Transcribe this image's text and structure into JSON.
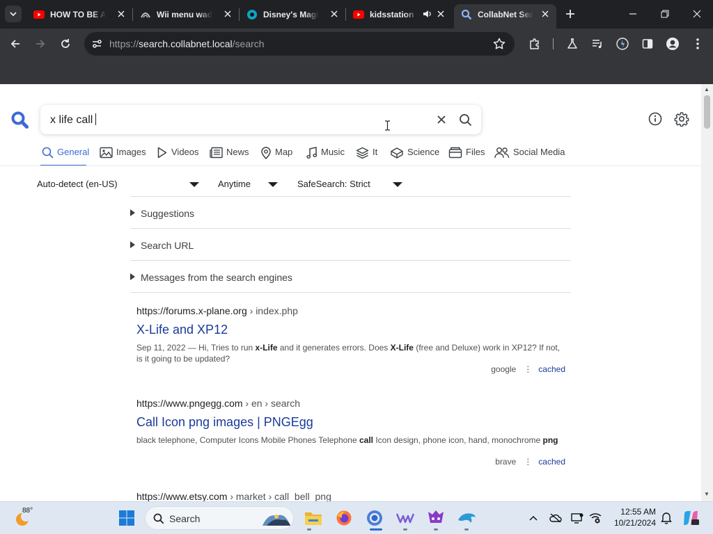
{
  "browser": {
    "tabs": [
      {
        "title": "HOW TO BE A",
        "favicon": "youtube-icon"
      },
      {
        "title": "Wii menu wad",
        "favicon": "wii-icon"
      },
      {
        "title": "Disney's Magic",
        "favicon": "disney-icon"
      },
      {
        "title": "kidsstation",
        "favicon": "youtube-icon"
      },
      {
        "title": "CollabNet Search",
        "favicon": "search-icon",
        "active": true
      }
    ],
    "url_scheme": "https://",
    "url_host": "search.collabnet.local",
    "url_path": "/search"
  },
  "search": {
    "query": "x life call"
  },
  "categories": [
    {
      "label": "General",
      "icon": "search-icon",
      "active": true
    },
    {
      "label": "Images",
      "icon": "image-icon"
    },
    {
      "label": "Videos",
      "icon": "play-icon"
    },
    {
      "label": "News",
      "icon": "newspaper-icon"
    },
    {
      "label": "Map",
      "icon": "map-pin-icon"
    },
    {
      "label": "Music",
      "icon": "music-note-icon"
    },
    {
      "label": "It",
      "icon": "layers-icon"
    },
    {
      "label": "Science",
      "icon": "science-icon"
    },
    {
      "label": "Files",
      "icon": "files-icon"
    },
    {
      "label": "Social Media",
      "icon": "people-icon"
    }
  ],
  "filters": {
    "language": "Auto-detect (en-US)",
    "time": "Anytime",
    "safesearch": "SafeSearch: Strict"
  },
  "panels": {
    "suggestions": "Suggestions",
    "search_url": "Search URL",
    "messages": "Messages from the search engines"
  },
  "results": [
    {
      "site": "https://forums.x-plane.org",
      "path": " › index.php",
      "title": "X-Life and XP12",
      "snippet_html": "Sep 11, 2022 — Hi, Tries to run <b>x-Life</b> and it generates errors. Does <b>X-Life</b> (free and Deluxe) work in XP12? If not, is it going to be updated?",
      "engine": "google",
      "cached": "cached"
    },
    {
      "site": "https://www.pngegg.com",
      "path": " › en › search",
      "title": "Call Icon png images | PNGEgg",
      "snippet_html": "black telephone, Computer Icons Mobile Phones Telephone <b>call</b> Icon design, phone icon, hand, monochrome <b>png</b>",
      "engine": "brave",
      "cached": "cached"
    },
    {
      "site": "https://www.etsy.com",
      "path": " › market › call_bell_png"
    }
  ],
  "taskbar": {
    "weather_temp": "88°",
    "search_label": "Search",
    "time": "12:55 AM",
    "date": "10/21/2024"
  },
  "colors": {
    "accent": "#3c6ad7",
    "link": "#1a3a9a"
  }
}
